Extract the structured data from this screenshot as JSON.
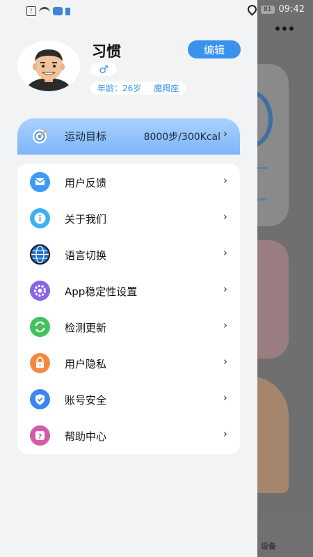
{
  "status_bar": {
    "time": "09:42",
    "battery": "81"
  },
  "profile": {
    "name": "习惯",
    "edit_label": "编辑",
    "gender_symbol": "♂",
    "age": "年龄：26岁",
    "zodiac": "魔羯座"
  },
  "goal": {
    "label": "运动目标",
    "value": "8000步/300Kcal",
    "chevron": "›"
  },
  "menu": {
    "items": [
      {
        "label": "用户反馈",
        "icon": "feedback-icon",
        "color": "#3d9bf2"
      },
      {
        "label": "关于我们",
        "icon": "info-icon",
        "color": "#3db0f2"
      },
      {
        "label": "语言切换",
        "icon": "globe-icon",
        "color": "#1e6ec8"
      },
      {
        "label": "App稳定性设置",
        "icon": "gear-icon",
        "color": "#8a63e6"
      },
      {
        "label": "检测更新",
        "icon": "refresh-icon",
        "color": "#43c15f"
      },
      {
        "label": "用户隐私",
        "icon": "lock-icon",
        "color": "#f28a3d"
      },
      {
        "label": "账号安全",
        "icon": "shield-icon",
        "color": "#3a86f0"
      },
      {
        "label": "帮助中心",
        "icon": "help-icon",
        "color": "#d45aa8"
      }
    ],
    "chevron": "›"
  },
  "background_app": {
    "tab_label": "设备"
  }
}
